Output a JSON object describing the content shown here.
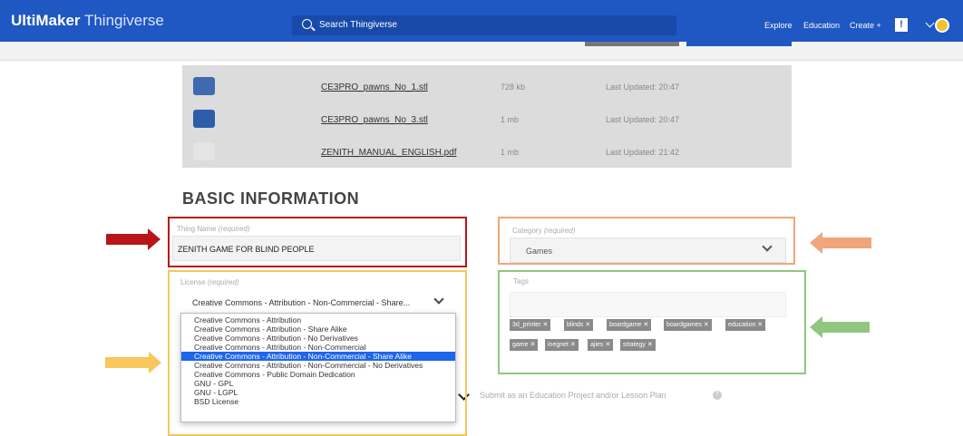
{
  "header": {
    "brand_bold": "UltiMaker",
    "brand_light": "Thingiverse",
    "search_placeholder": "Search Thingiverse",
    "nav": {
      "explore": "Explore",
      "education": "Education",
      "create": "Create +"
    },
    "user_badge": "!"
  },
  "files": [
    {
      "name": "CE3PRO_pawns_No_1.stl",
      "size": "728 kb",
      "updated": "Last Updated: 20:47",
      "thumb_color": "#3f6ab0"
    },
    {
      "name": "CE3PRO_pawns_No_3.stl",
      "size": "1 mb",
      "updated": "Last Updated: 20:47",
      "thumb_color": "#2d5da8"
    },
    {
      "name": "ZENITH_MANUAL_ENGLISH.pdf",
      "size": "1 mb",
      "updated": "Last Updated: 21:42",
      "thumb_color": "#e4e4e4"
    }
  ],
  "section_title": "BASIC INFORMATION",
  "thing_name": {
    "label": "Thing Name",
    "required": "(required)",
    "value": "ZENITH GAME FOR BLIND PEOPLE"
  },
  "category": {
    "label": "Category",
    "required": "(required)",
    "value": "Games"
  },
  "license": {
    "label": "License",
    "required": "(required)",
    "value": "Creative Commons - Attribution - Non-Commercial - Share...",
    "options": [
      "Creative Commons - Attribution",
      "Creative Commons - Attribution - Share Alike",
      "Creative Commons - Attribution - No Derivatives",
      "Creative Commons - Attribution - Non-Commercial",
      "Creative Commons - Attribution - Non-Commercial - Share Alike",
      "Creative Commons - Attribution - Non-Commercial - No Derivatives",
      "Creative Commons - Public Domain Dedication",
      "GNU - GPL",
      "GNU - LGPL",
      "BSD License"
    ],
    "selected_index": 4
  },
  "tags": {
    "label": "Tags",
    "items": [
      "3d_printer",
      "blinds",
      "boardgame",
      "boardgames",
      "education",
      "game",
      "inegnet",
      "ajies",
      "strategy"
    ]
  },
  "education_option": "Submit as an Education Project and/or Lesson Plan",
  "annotation_colors": {
    "red": "#b8151b",
    "orange": "#f0a57a",
    "yellow": "#f8c65a",
    "green": "#90c77f"
  }
}
